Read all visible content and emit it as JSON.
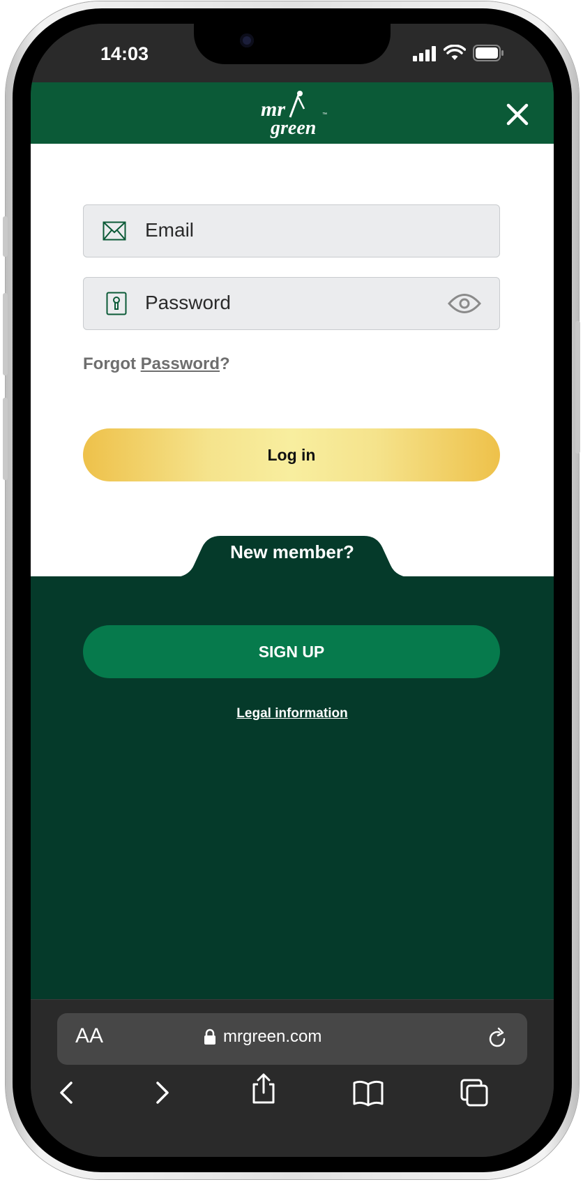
{
  "status_bar": {
    "time": "14:03"
  },
  "header": {
    "logo_text": "mr green"
  },
  "login": {
    "email_placeholder": "Email",
    "password_placeholder": "Password",
    "forgot_prefix": "Forgot ",
    "forgot_link": "Password",
    "forgot_suffix": "?",
    "login_button": "Log in"
  },
  "signup": {
    "new_member_label": "New member?",
    "signup_button": "SIGN UP",
    "legal_link": "Legal information"
  },
  "browser": {
    "text_size_label": "AA",
    "url": "mrgreen.com"
  },
  "colors": {
    "header_green": "#0b5a37",
    "dark_green": "#053a2a",
    "signup_green": "#067a4c",
    "gold": "#eec14a"
  }
}
